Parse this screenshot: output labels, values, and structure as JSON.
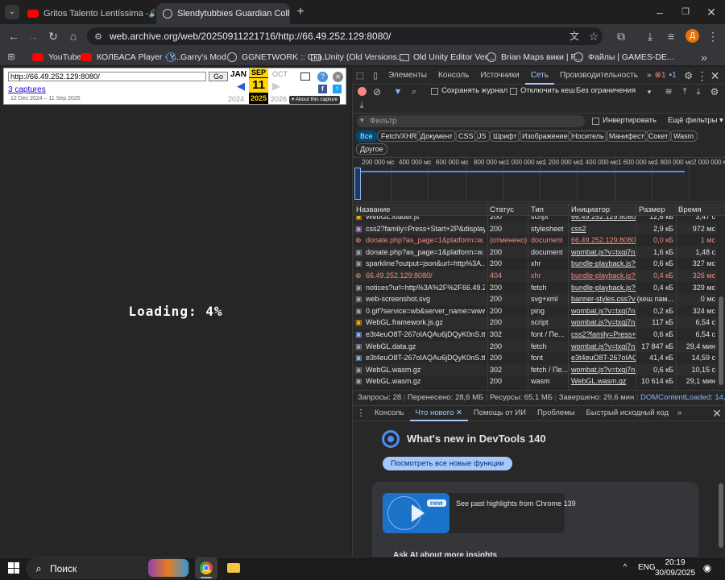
{
  "tabs": [
    {
      "title": "Gritos Talento Lentíssima -"
    },
    {
      "title": "Slendytubbies Guardian Collec"
    }
  ],
  "address": "web.archive.org/web/20250911221716/http://66.49.252.129:8080/",
  "profile_initial": "Д",
  "bookmarks": [
    {
      "label": "YouTube"
    },
    {
      "label": "КОЛБАСА Player - Y..."
    },
    {
      "label": "Garry's Mod"
    },
    {
      "label": "GGNETWORK :: Ска..."
    },
    {
      "label": "Unity (Old Versions..."
    },
    {
      "label": "Old Unity Editor Ver..."
    },
    {
      "label": "Brian Maps вики | F..."
    },
    {
      "label": "Файлы | GAMES-DE..."
    }
  ],
  "wayback": {
    "url": "http://66.49.252.129:8080/",
    "go": "Go",
    "captures": "3 captures",
    "range": "12 Dec 2024 – 11 Sep 2025",
    "prev_month": "JAN",
    "cur_month": "SEP",
    "next_month": "OCT",
    "day": "11",
    "prev_year": "2024",
    "cur_year": "2025",
    "next_year": "2026",
    "about": "▾ About this capture"
  },
  "loading": "Loading: 4%",
  "devtools": {
    "tabs": [
      "Элементы",
      "Консоль",
      "Источники",
      "Сеть",
      "Производительность"
    ],
    "badges": {
      "errors": "1",
      "messages": "1"
    },
    "preserve_log": "Сохранять журнал",
    "disable_cache": "Отключить кеш",
    "throttle": "Без ограничения",
    "filter_placeholder": "Фильтр",
    "invert": "Инвертировать",
    "more_filters": "Ещё фильтры",
    "chips": [
      "Все",
      "Fetch/XHR",
      "Документ",
      "CSS",
      "JS",
      "Шрифт",
      "Изображение",
      "Носитель",
      "Манифест",
      "Сокет",
      "Wasm",
      "Другое"
    ],
    "ticks": [
      "200 000 мс",
      "400 000 мс",
      "600 000 мс",
      "800 000 мс",
      "1 000 000 мс",
      "1 200 000 мс",
      "1 400 000 мс",
      "1 600 000 мс",
      "1 800 000 мс",
      "2 000 000 м"
    ],
    "columns": [
      "Название",
      "Статус",
      "Тип",
      "Инициатор",
      "Размер",
      "Время"
    ],
    "rows": [
      {
        "name": "WebGL.loader.js",
        "status": "200",
        "type": "script",
        "init": "66.49.252.129:8080/:",
        "size": "12,6 кБ",
        "time": "3,47 с",
        "err": false
      },
      {
        "name": "css2?family=Press+Start+2P&display...",
        "status": "200",
        "type": "stylesheet",
        "init": "css2",
        "size": "2,9 кБ",
        "time": "972 мс",
        "err": false
      },
      {
        "name": "donate.php?as_page=1&platform=w...",
        "status": "(отменено)",
        "type": "document",
        "init": "66.49.252.129:8080/:7",
        "size": "0,0 кБ",
        "time": "1 мс",
        "err": true
      },
      {
        "name": "donate.php?as_page=1&platform=w...",
        "status": "200",
        "type": "document",
        "init": "wombat.js?v=txqj7nK",
        "size": "1,6 кБ",
        "time": "1,48 с",
        "err": false
      },
      {
        "name": "sparkline?output=json&url=http%3A...",
        "status": "200",
        "type": "xhr",
        "init": "bundle-playback.js?v=",
        "size": "0,6 кБ",
        "time": "327 мс",
        "err": false
      },
      {
        "name": "66.49.252.129:8080/",
        "status": "404",
        "type": "xhr",
        "init": "bundle-playback.js?v=",
        "size": "0,4 кБ",
        "time": "326 мс",
        "err": true
      },
      {
        "name": "notices?url=http%3A%2F%2F66.49.25...",
        "status": "200",
        "type": "fetch",
        "init": "bundle-playback.js?v=",
        "size": "0,4 кБ",
        "time": "329 мс",
        "err": false
      },
      {
        "name": "web-screenshot.svg",
        "status": "200",
        "type": "svg+xml",
        "init": "banner-styles.css?v=",
        "size": "(кеш пам...",
        "time": "0 мс",
        "err": false
      },
      {
        "name": "0.gif?service=wb&server_name=www...",
        "status": "200",
        "type": "ping",
        "init": "wombat.js?v=txqj7nK",
        "size": "0,2 кБ",
        "time": "324 мс",
        "err": false
      },
      {
        "name": "WebGL.framework.js.gz",
        "status": "200",
        "type": "script",
        "init": "wombat.js?v=txqj7nK",
        "size": "117 кБ",
        "time": "6,54 с",
        "err": false
      },
      {
        "name": "e3t4euO8T-267oIAQAu6jDQyK0nS.ttf",
        "status": "302",
        "type": "font / Пе...",
        "init": "css2?family=Press+St",
        "size": "0,6 кБ",
        "time": "6,54 с",
        "err": false
      },
      {
        "name": "WebGL.data.gz",
        "status": "200",
        "type": "fetch",
        "init": "wombat.js?v=txqj7nK",
        "size": "17 847 кБ",
        "time": "29,4 мин",
        "err": false
      },
      {
        "name": "e3t4euO8T-267oIAQAu6jDQyK0nS.ttf",
        "status": "200",
        "type": "font",
        "init": "e3t4euO8T-267oIAQA",
        "size": "41,4 кБ",
        "time": "14,59 с",
        "err": false
      },
      {
        "name": "WebGL.wasm.gz",
        "status": "302",
        "type": "fetch / Пе...",
        "init": "wombat.js?v=txqj7nK",
        "size": "0,6 кБ",
        "time": "10,15 с",
        "err": false
      },
      {
        "name": "WebGL.wasm.gz",
        "status": "200",
        "type": "wasm",
        "init": "WebGL.wasm.gz",
        "size": "10 614 кБ",
        "time": "29,1 мин",
        "err": false
      }
    ],
    "summary": {
      "requests": "Запросы: 28",
      "transferred": "Перенесено: 28,6 МБ",
      "resources": "Ресурсы: 65,1 МБ",
      "finished": "Завершено: 29,6 мин",
      "dcl": "DOMContentLoaded: 14,65 с"
    },
    "drawer_tabs": [
      "Консоль",
      "Что нового",
      "Помощь от ИИ",
      "Проблемы",
      "Быстрый исходный код"
    ],
    "whats_new": "What's new in DevTools 140",
    "see_all": "Посмотреть все новые функции",
    "new_badge": "new",
    "highlights": "See past highlights from Chrome 139",
    "ask_ai": "Ask AI about more insights"
  },
  "taskbar": {
    "search": "Поиск",
    "lang": "ENG",
    "time": "20:19",
    "date": "30/09/2025"
  }
}
